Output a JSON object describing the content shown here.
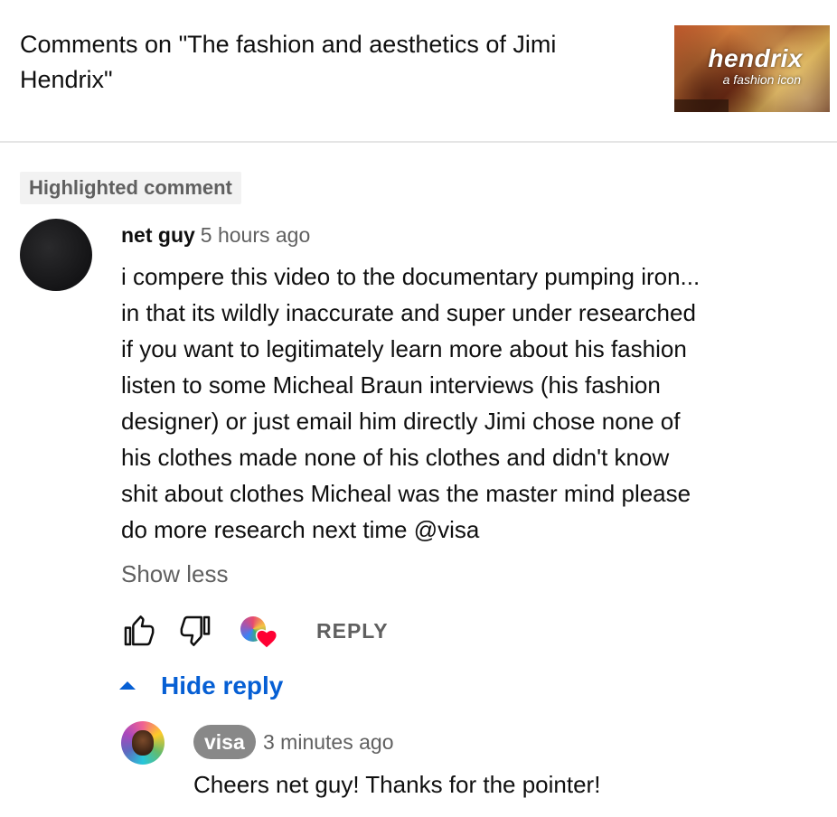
{
  "header": {
    "title_line1": "Comments on \"The fashion and aesthetics of Jimi",
    "title_line2": "Hendrix\"",
    "thumbnail": {
      "title": "hendrix",
      "subtitle": "a fashion icon"
    }
  },
  "highlight_badge": "Highlighted comment",
  "comment": {
    "author": "net guy",
    "time": "5 hours ago",
    "lines": [
      "i compere this video to the documentary pumping iron...",
      "in that its wildly inaccurate and super under researched",
      "if you want to legitimately learn more about his fashion",
      "listen to some Micheal Braun interviews (his fashion",
      "designer) or just email him directly  Jimi chose none of",
      "his clothes made none of his clothes and didn't know",
      "shit about clothes Micheal was the master mind please",
      "do more research next time @visa"
    ],
    "show_less": "Show less",
    "actions": {
      "like_icon": "thumbs-up-icon",
      "dislike_icon": "thumbs-down-icon",
      "hearted_icon": "creator-heart-icon",
      "reply_label": "REPLY"
    }
  },
  "replies_toggle": {
    "icon": "caret-up-icon",
    "label": "Hide reply"
  },
  "reply": {
    "author": "visa",
    "time": "3 minutes ago",
    "text": "Cheers net guy! Thanks for the pointer!"
  },
  "colors": {
    "link_blue": "#065fd4",
    "secondary_text": "#606060",
    "heart_red": "#ff0033",
    "author_chip": "#888888"
  }
}
